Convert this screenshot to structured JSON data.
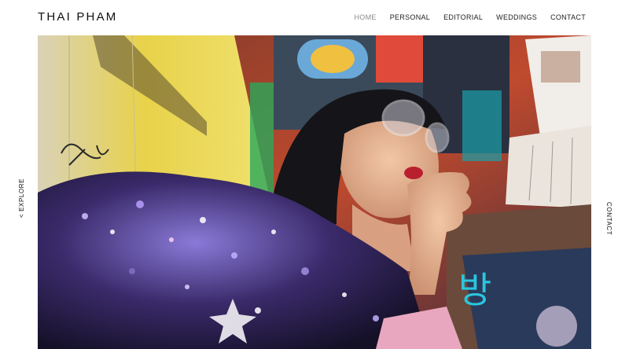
{
  "site": {
    "logo": "THAI PHAM"
  },
  "nav": {
    "items": [
      {
        "label": "HOME",
        "active": true
      },
      {
        "label": "PERSONAL",
        "active": false
      },
      {
        "label": "EDITORIAL",
        "active": false
      },
      {
        "label": "WEDDINGS",
        "active": false
      },
      {
        "label": "CONTACT",
        "active": false
      }
    ]
  },
  "side": {
    "explore_label": "< EXPLORE",
    "contact_label": "CONTACT"
  },
  "hero": {
    "sign_text": "방"
  },
  "colors": {
    "active_nav": "#8a8a8a",
    "text": "#111111",
    "wall_yellow": "#e6c933",
    "neon_red": "#d9472f",
    "neon_cyan": "#29c6e0"
  }
}
